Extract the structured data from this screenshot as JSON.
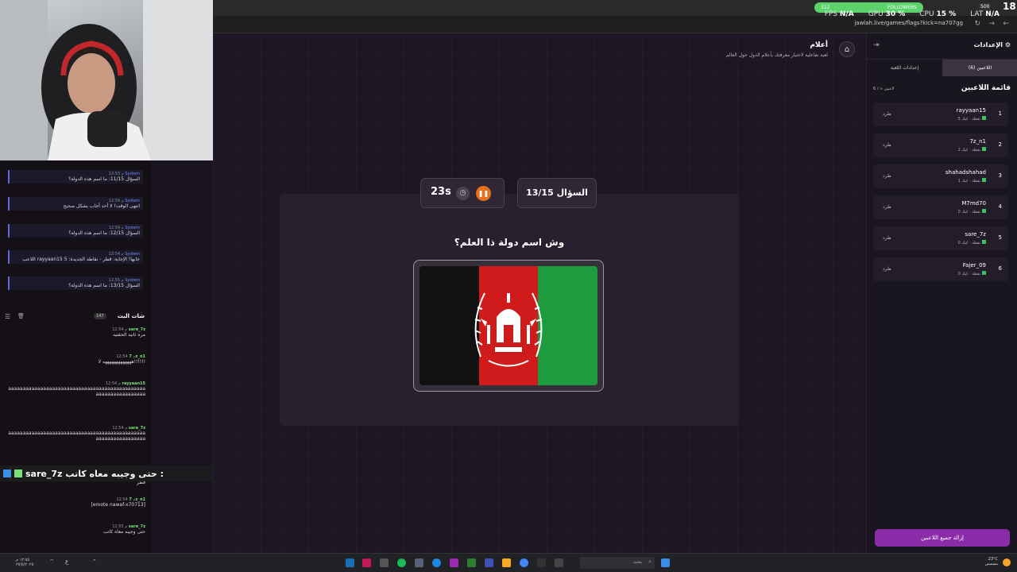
{
  "browser": {
    "url": "jawlah.live/games/flags?kick=na707gg",
    "stats": [
      {
        "label": "FPS",
        "value": "N/A"
      },
      {
        "label": "GPU",
        "value": "30 %"
      },
      {
        "label": "CPU",
        "value": "15 %"
      },
      {
        "label": "LAT",
        "value": "N/A"
      }
    ],
    "followers_label": "FOLLOWERS",
    "followers_current": "312",
    "followers_goal_small": "500",
    "followers_badge": "18"
  },
  "game": {
    "title": "أعلام",
    "description": "لعبة تفاعلية لاختبار معرفتك بأعلام الدول حول العالم",
    "timer": "23s",
    "question_counter": "السؤال 13/15",
    "question": "وش اسم دولة ذا العلم؟",
    "flag_colors": [
      "#111111",
      "#cf1b1b",
      "#1e9b3e"
    ]
  },
  "system_messages": [
    {
      "name": "System",
      "time": "12:53 م",
      "text": "السؤال 11/15: ما اسم هذه الدولة؟"
    },
    {
      "name": "System",
      "time": "12:54 م",
      "text": "انتهى الوقت! لا أحد أجاب بشكل صحيح"
    },
    {
      "name": "System",
      "time": "12:54 م",
      "text": "السؤال 12/15: ما اسم هذه الدولة؟"
    },
    {
      "name": "System",
      "time": "12:54 م",
      "text": "اللاعب rayyaan15 جابها! الإجابة: قطر - نقاطه الجديدة: 5"
    },
    {
      "name": "System",
      "time": "12:55 م",
      "text": "السؤال 13/15: ما اسم هذه الدولة؟"
    }
  ],
  "chat": {
    "title": "شات البث",
    "count": "147",
    "messages": [
      {
        "user": "sare_7z",
        "time": "12:54 م",
        "text": "مره ثانيه الحقتيه"
      },
      {
        "user": "7z_n1",
        "time": "12:54 م",
        "text": "هههههههههههههه لا!!!!!!"
      },
      {
        "user": "rayyaan15",
        "time": "12:54 م",
        "text": "aaaaaaaaaaaaaaaaaaaaaaaaaaaaaaaaaaaaaaaaaaaaaaaaaaaaaaaaaaaaaaaa"
      },
      {
        "user": "sare_7z",
        "time": "12:54 م",
        "text": "aaaaaaaaaaaaaaaaaaaaaaaaaaaaaaaaaaaaaaaaaaaaaaaaaaaaaaaaaaaaaaaa"
      },
      {
        "user": "",
        "time": "",
        "text": "قطر"
      },
      {
        "user": "7z_n1",
        "time": "12:54 م",
        "text": "[emote nawaf-x70713]"
      },
      {
        "user": "sare_7z",
        "time": "12:55 م",
        "text": "حتى وجيبه معاه كاتب"
      }
    ],
    "highlight_user": "sare_7z",
    "highlight_text": "حتى وجيبه معاه كاتب :"
  },
  "panel": {
    "title": "الإعدادات",
    "tabs": [
      "إعدادات اللعبة",
      "اللاعبين (6)"
    ],
    "players_title": "قائمة اللاعبين",
    "players_count": "6 / ∞ لاعبين",
    "kick_label": "طرد",
    "players": [
      {
        "rank": "1",
        "name": "rayyaan15",
        "score": "5 نقطة · كيك"
      },
      {
        "rank": "2",
        "name": "7z_n1",
        "score": "2 نقطة · كيك"
      },
      {
        "rank": "3",
        "name": "shahadshahad",
        "score": "1 نقطة · كيك"
      },
      {
        "rank": "4",
        "name": "M7md70",
        "score": "0 نقطة · كيك"
      },
      {
        "rank": "5",
        "name": "sare_7z",
        "score": "0 نقطة · كيك"
      },
      {
        "rank": "6",
        "name": "Fajer_09",
        "score": "0 نقطة · كيك"
      }
    ],
    "remove_all": "إزالة جميع اللاعبين"
  },
  "taskbar": {
    "search_placeholder": "بحث",
    "weather_temp": "23°C",
    "weather_desc": "مشمس",
    "clock_time": "١٢:٥٥ م",
    "clock_date": "٢٧/٥/٢٠٢٥"
  }
}
